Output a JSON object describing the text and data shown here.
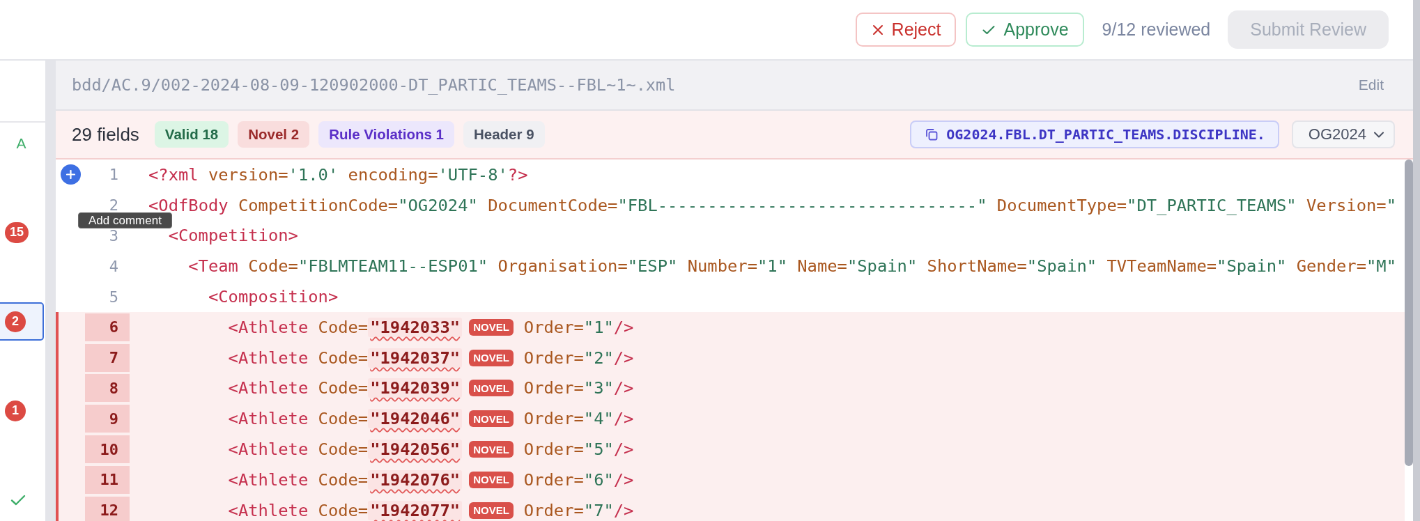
{
  "toolbar": {
    "actions": [
      {
        "kind": "reject",
        "label": "Reject"
      },
      {
        "kind": "approve",
        "label": "Approve"
      }
    ],
    "progress": "9/12 reviewed",
    "submit": {
      "label": "Submit Review",
      "disabled": true
    }
  },
  "sidebar": {
    "items": [
      {
        "kind": "letter",
        "text": "A",
        "selected": false
      },
      {
        "kind": "count",
        "text": "15",
        "selected": false
      },
      {
        "kind": "count",
        "text": "2",
        "selected": true
      },
      {
        "kind": "count",
        "text": "1",
        "selected": false
      },
      {
        "kind": "check",
        "selected": false
      }
    ]
  },
  "file": {
    "path": "bdd/AC.9/002-2024-08-09-120902000-DT_PARTIC_TEAMS--FBL~1~.xml",
    "action": "Edit"
  },
  "summary": {
    "count": "29 fields",
    "tags": [
      {
        "kind": "valid",
        "label": "Valid 18"
      },
      {
        "kind": "novel",
        "label": "Novel 2"
      },
      {
        "kind": "rule",
        "label": "Rule Violations 1"
      },
      {
        "kind": "header",
        "label": "Header 9"
      }
    ],
    "key": "OG2024.FBL.DT_PARTIC_TEAMS.DISCIPLINE.",
    "version": "OG2024"
  },
  "editor": {
    "tooltip": "Add comment",
    "lines": [
      {
        "number": "1",
        "changed": false,
        "hovered": true,
        "tokens": [
          {
            "kind": "tag",
            "text": "<?xml"
          },
          {
            "kind": "attr",
            "text": "version="
          },
          {
            "kind": "value",
            "text": "'1.0'"
          },
          {
            "kind": "attr",
            "text": "encoding="
          },
          {
            "kind": "value",
            "text": "'UTF-8'"
          },
          {
            "kind": "tag",
            "text": "?>"
          }
        ]
      },
      {
        "number": "2",
        "changed": false,
        "hovered": false,
        "tokens": [
          {
            "kind": "tag",
            "text": "<OdfBody"
          },
          {
            "kind": "attr",
            "text": "CompetitionCode="
          },
          {
            "kind": "value",
            "text": "\"OG2024\""
          },
          {
            "kind": "attr",
            "text": "DocumentCode="
          },
          {
            "kind": "value",
            "text": "\"FBL--------------------------------\""
          },
          {
            "kind": "attr",
            "text": "DocumentType="
          },
          {
            "kind": "value",
            "text": "\"DT_PARTIC_TEAMS\""
          },
          {
            "kind": "attr",
            "text": "Version="
          },
          {
            "kind": "value",
            "text": "\""
          }
        ],
        "children": [
          {
            "number": "3",
            "changed": false,
            "hovered": false,
            "tokens": [
              {
                "kind": "tag",
                "text": "<Competition>"
              }
            ],
            "children": [
              {
                "number": "4",
                "changed": false,
                "hovered": false,
                "tokens": [
                  {
                    "kind": "tag",
                    "text": "<Team"
                  },
                  {
                    "kind": "attr",
                    "text": "Code="
                  },
                  {
                    "kind": "value",
                    "text": "\"FBLMTEAM11--ESP01\""
                  },
                  {
                    "kind": "attr",
                    "text": "Organisation="
                  },
                  {
                    "kind": "value",
                    "text": "\"ESP\""
                  },
                  {
                    "kind": "attr",
                    "text": "Number="
                  },
                  {
                    "kind": "value",
                    "text": "\"1\""
                  },
                  {
                    "kind": "attr",
                    "text": "Name="
                  },
                  {
                    "kind": "value",
                    "text": "\"Spain\""
                  },
                  {
                    "kind": "attr",
                    "text": "ShortName="
                  },
                  {
                    "kind": "value",
                    "text": "\"Spain\""
                  },
                  {
                    "kind": "attr",
                    "text": "TVTeamName="
                  },
                  {
                    "kind": "value",
                    "text": "\"Spain\""
                  },
                  {
                    "kind": "attr",
                    "text": "Gender="
                  },
                  {
                    "kind": "value",
                    "text": "\"M\""
                  }
                ],
                "children": [
                  {
                    "number": "5",
                    "changed": false,
                    "hovered": false,
                    "tokens": [
                      {
                        "kind": "tag",
                        "text": "<Composition>"
                      }
                    ],
                    "children": [
                      {
                        "number": "6",
                        "changed": true,
                        "hovered": false,
                        "tokens": [
                          {
                            "kind": "tag",
                            "text": "<Athlete"
                          },
                          {
                            "kind": "attr",
                            "text": "Code="
                          },
                          {
                            "kind": "flag",
                            "text": "\"1942033\""
                          },
                          {
                            "kind": "badge",
                            "text": "NOVEL"
                          },
                          {
                            "kind": "attr",
                            "text": "Order="
                          },
                          {
                            "kind": "value",
                            "text": "\"1\""
                          },
                          {
                            "kind": "tag",
                            "text": "/>"
                          }
                        ]
                      },
                      {
                        "number": "7",
                        "changed": true,
                        "hovered": false,
                        "tokens": [
                          {
                            "kind": "tag",
                            "text": "<Athlete"
                          },
                          {
                            "kind": "attr",
                            "text": "Code="
                          },
                          {
                            "kind": "flag",
                            "text": "\"1942037\""
                          },
                          {
                            "kind": "badge",
                            "text": "NOVEL"
                          },
                          {
                            "kind": "attr",
                            "text": "Order="
                          },
                          {
                            "kind": "value",
                            "text": "\"2\""
                          },
                          {
                            "kind": "tag",
                            "text": "/>"
                          }
                        ]
                      },
                      {
                        "number": "8",
                        "changed": true,
                        "hovered": false,
                        "tokens": [
                          {
                            "kind": "tag",
                            "text": "<Athlete"
                          },
                          {
                            "kind": "attr",
                            "text": "Code="
                          },
                          {
                            "kind": "flag",
                            "text": "\"1942039\""
                          },
                          {
                            "kind": "badge",
                            "text": "NOVEL"
                          },
                          {
                            "kind": "attr",
                            "text": "Order="
                          },
                          {
                            "kind": "value",
                            "text": "\"3\""
                          },
                          {
                            "kind": "tag",
                            "text": "/>"
                          }
                        ]
                      },
                      {
                        "number": "9",
                        "changed": true,
                        "hovered": false,
                        "tokens": [
                          {
                            "kind": "tag",
                            "text": "<Athlete"
                          },
                          {
                            "kind": "attr",
                            "text": "Code="
                          },
                          {
                            "kind": "flag",
                            "text": "\"1942046\""
                          },
                          {
                            "kind": "badge",
                            "text": "NOVEL"
                          },
                          {
                            "kind": "attr",
                            "text": "Order="
                          },
                          {
                            "kind": "value",
                            "text": "\"4\""
                          },
                          {
                            "kind": "tag",
                            "text": "/>"
                          }
                        ]
                      },
                      {
                        "number": "10",
                        "changed": true,
                        "hovered": false,
                        "tokens": [
                          {
                            "kind": "tag",
                            "text": "<Athlete"
                          },
                          {
                            "kind": "attr",
                            "text": "Code="
                          },
                          {
                            "kind": "flag",
                            "text": "\"1942056\""
                          },
                          {
                            "kind": "badge",
                            "text": "NOVEL"
                          },
                          {
                            "kind": "attr",
                            "text": "Order="
                          },
                          {
                            "kind": "value",
                            "text": "\"5\""
                          },
                          {
                            "kind": "tag",
                            "text": "/>"
                          }
                        ]
                      },
                      {
                        "number": "11",
                        "changed": true,
                        "hovered": false,
                        "tokens": [
                          {
                            "kind": "tag",
                            "text": "<Athlete"
                          },
                          {
                            "kind": "attr",
                            "text": "Code="
                          },
                          {
                            "kind": "flag",
                            "text": "\"1942076\""
                          },
                          {
                            "kind": "badge",
                            "text": "NOVEL"
                          },
                          {
                            "kind": "attr",
                            "text": "Order="
                          },
                          {
                            "kind": "value",
                            "text": "\"6\""
                          },
                          {
                            "kind": "tag",
                            "text": "/>"
                          }
                        ]
                      },
                      {
                        "number": "12",
                        "changed": true,
                        "hovered": false,
                        "tokens": [
                          {
                            "kind": "tag",
                            "text": "<Athlete"
                          },
                          {
                            "kind": "attr",
                            "text": "Code="
                          },
                          {
                            "kind": "flag",
                            "text": "\"1942077\""
                          },
                          {
                            "kind": "badge",
                            "text": "NOVEL"
                          },
                          {
                            "kind": "attr",
                            "text": "Order="
                          },
                          {
                            "kind": "value",
                            "text": "\"7\""
                          },
                          {
                            "kind": "tag",
                            "text": "/>"
                          }
                        ]
                      }
                    ]
                  }
                ]
              }
            ]
          }
        ]
      }
    ]
  }
}
